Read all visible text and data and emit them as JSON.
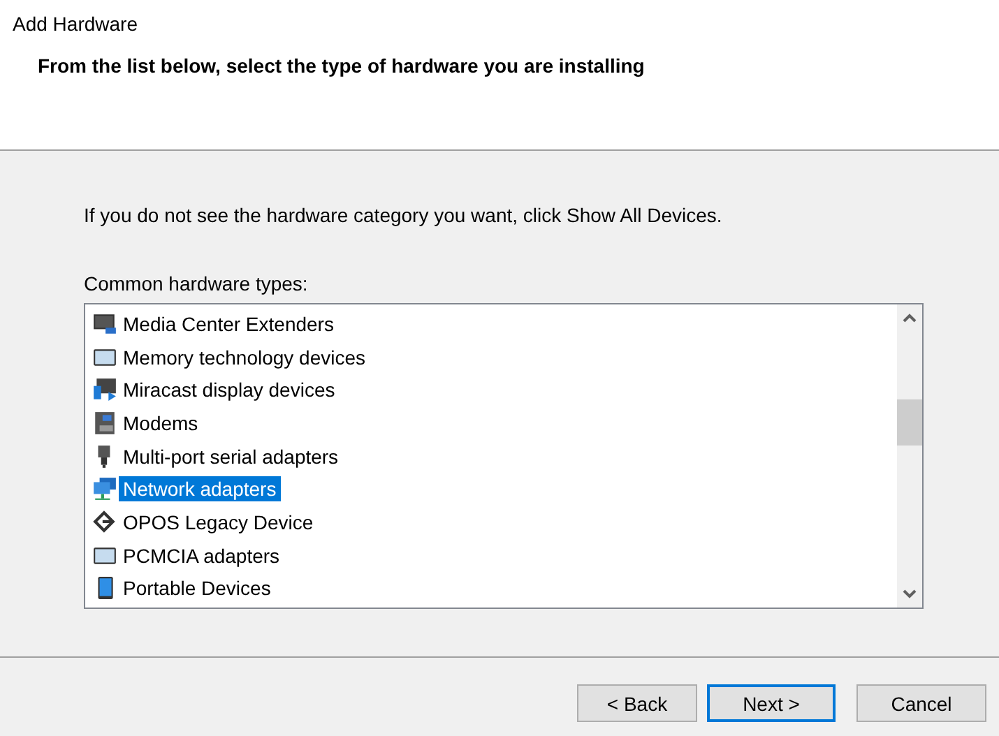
{
  "window": {
    "title": "Add Hardware"
  },
  "header": {
    "heading": "From the list below, select the type of hardware you are installing"
  },
  "intro": "If you do not see the hardware category you want, click Show All Devices.",
  "list_label": "Common hardware types:",
  "hardware_types": [
    {
      "label": "Media Center Extenders",
      "selected": false
    },
    {
      "label": "Memory technology devices",
      "selected": false
    },
    {
      "label": "Miracast display devices",
      "selected": false
    },
    {
      "label": "Modems",
      "selected": false
    },
    {
      "label": "Multi-port serial adapters",
      "selected": false
    },
    {
      "label": "Network adapters",
      "selected": true
    },
    {
      "label": "OPOS Legacy Device",
      "selected": false
    },
    {
      "label": "PCMCIA adapters",
      "selected": false
    },
    {
      "label": "Portable Devices",
      "selected": false
    }
  ],
  "buttons": [
    {
      "label": "< Back",
      "default": false
    },
    {
      "label": "Next >",
      "default": true
    },
    {
      "label": "Cancel",
      "default": false
    }
  ]
}
